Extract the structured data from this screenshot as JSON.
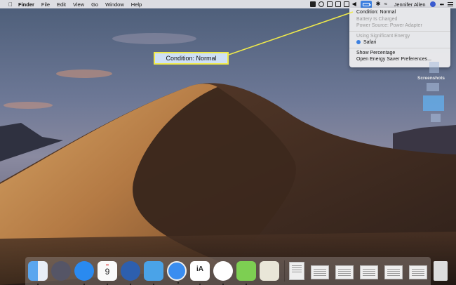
{
  "menubar": {
    "app_name": "Finder",
    "menus": [
      "File",
      "Edit",
      "View",
      "Go",
      "Window",
      "Help"
    ],
    "user_name": "Jennifer Allen"
  },
  "battery_menu": {
    "items": [
      {
        "label": "Condition: Normal",
        "enabled": true
      },
      {
        "label": "Battery Is Charged",
        "enabled": false
      },
      {
        "label": "Power Source: Power Adapter",
        "enabled": false
      }
    ],
    "energy_header": "Using Significant Energy",
    "energy_apps": [
      "Safari"
    ],
    "actions": [
      "Show Percentage",
      "Open Energy Saver Preferences..."
    ]
  },
  "callout": {
    "text": "Condition: Normal",
    "border_color": "#f0ea4a",
    "fill_color": "#cfe0f5"
  },
  "desktop": {
    "folder_label": "Screenshots"
  },
  "dock": {
    "apps": [
      "finder-icon",
      "launchpad-icon",
      "app-store-icon",
      "calendar-icon",
      "thunderbird-icon",
      "tweetbot-icon",
      "safari-icon",
      "ia-writer-icon",
      "slack-icon",
      "kite-icon",
      "notes-icon"
    ],
    "calendar_day": "9",
    "ia_writer_label": "iA"
  }
}
